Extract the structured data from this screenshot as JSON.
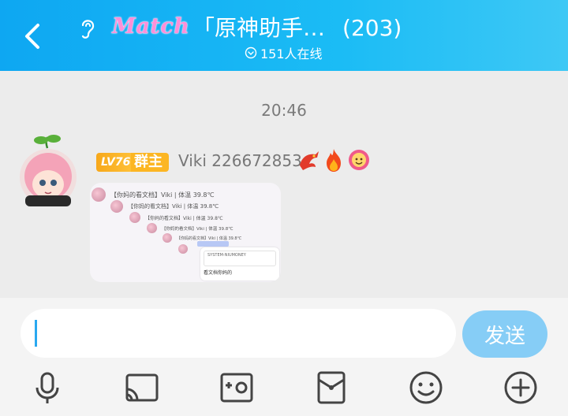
{
  "header": {
    "back_icon": "chevron-left-icon",
    "ear_icon": "ear-icon",
    "match_logo": "Match",
    "group_title": "「原神助手…",
    "member_count": "(203)",
    "online_text": "151人在线"
  },
  "chat": {
    "timestamp": "20:46",
    "message": {
      "level_badge": "LV76",
      "role_badge": "群主",
      "sender_name": "Viki 226672853",
      "image_rows": [
        "【你妈的看文档】Viki | 体温 39.8℃",
        "【你妈的看文档】Viki | 体温 39.8℃",
        "【你妈的看文档】Viki | 体温 39.8℃",
        "【你妈的看文档】Viki | 体温 39.8℃",
        "【你妈的看文档】Viki | 体温 39.8℃"
      ],
      "card_title": "SYSTEM-NIUMONEY",
      "card_line": "看文档你妈的"
    }
  },
  "input": {
    "value": "",
    "send_label": "发送"
  },
  "toolbar": {
    "items": [
      "microphone-icon",
      "screen-share-icon",
      "photo-icon",
      "red-packet-icon",
      "emoji-icon",
      "plus-icon"
    ]
  },
  "colors": {
    "header": "#0ea7f2",
    "send_button": "#86cdf6",
    "level_badge": "#f7a81a",
    "caret": "#29a8f0"
  }
}
